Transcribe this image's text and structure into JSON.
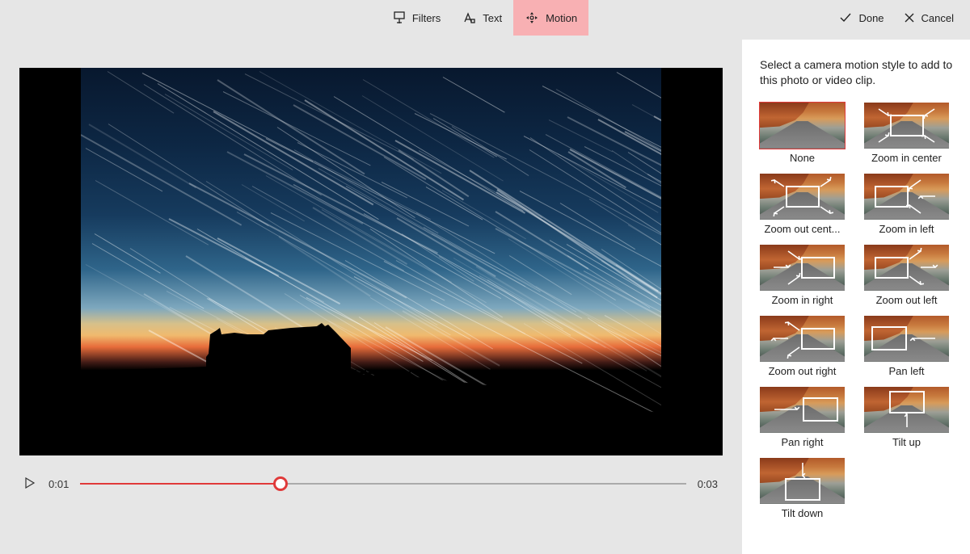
{
  "toolbar": {
    "filters": "Filters",
    "text": "Text",
    "motion": "Motion",
    "done": "Done",
    "cancel": "Cancel",
    "active": "motion"
  },
  "playback": {
    "current": "0:01",
    "total": "0:03",
    "progress_percent": 33
  },
  "panel": {
    "description": "Select a camera motion style to add to this photo or video clip.",
    "selected": "None",
    "items": [
      {
        "label": "None",
        "overlay": "none"
      },
      {
        "label": "Zoom in center",
        "overlay": "zoom_in_center"
      },
      {
        "label": "Zoom out cent...",
        "overlay": "zoom_out_center"
      },
      {
        "label": "Zoom in left",
        "overlay": "zoom_in_left"
      },
      {
        "label": "Zoom in right",
        "overlay": "zoom_in_right"
      },
      {
        "label": "Zoom out left",
        "overlay": "zoom_out_left"
      },
      {
        "label": "Zoom out right",
        "overlay": "zoom_out_right"
      },
      {
        "label": "Pan left",
        "overlay": "pan_left"
      },
      {
        "label": "Pan right",
        "overlay": "pan_right"
      },
      {
        "label": "Tilt up",
        "overlay": "tilt_up"
      },
      {
        "label": "Tilt down",
        "overlay": "tilt_down"
      }
    ]
  }
}
